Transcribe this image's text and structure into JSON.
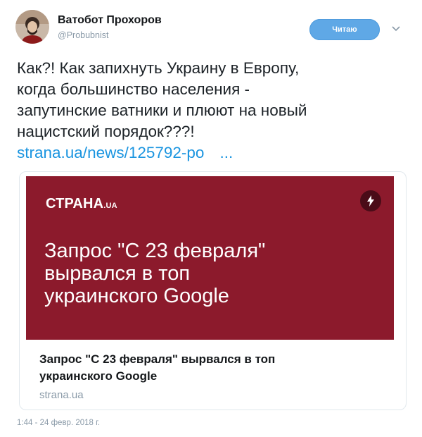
{
  "author": {
    "name": "Ватобот Прохоров",
    "handle": "@Probubnist"
  },
  "follow_button": {
    "label": "Читаю"
  },
  "tweet": {
    "lines": [
      "Как?! Как запихнуть Украину в Европу,",
      "когда большинство населения -",
      "запутинские ватники и плюют на новый",
      "нацистский порядок???!"
    ],
    "link": "strana.ua/news/125792-po",
    "link_ellipsis": "..."
  },
  "card": {
    "brand": "СТРАНА",
    "brand_tld": ".UA",
    "badge_icon": "lightning-bolt-icon",
    "image_headline": [
      "Запрос \"С 23 февраля\"",
      "вырвался в топ",
      "украинского Google"
    ],
    "title": [
      "Запрос \"С 23 февраля\" вырвался в топ",
      "украинского Google"
    ],
    "domain": "strana.ua"
  },
  "timestamp": "1:44 - 24 февр. 2018 г.",
  "colors": {
    "card_image_bg": "#8c1a2c",
    "link": "#1b95e0",
    "follow_button": "#5fa8e6"
  }
}
